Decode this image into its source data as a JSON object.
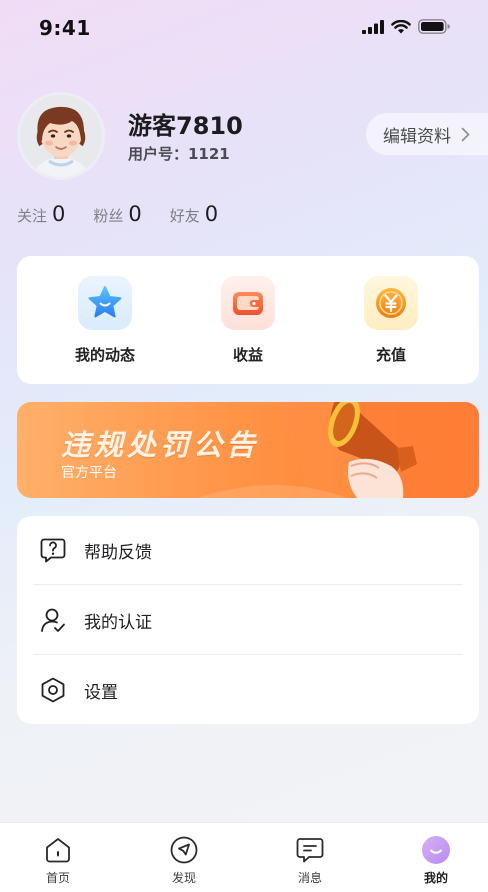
{
  "status_bar": {
    "time": "9:41"
  },
  "profile": {
    "username": "游客7810",
    "user_id": "用户号：1121",
    "edit_label": "编辑资料",
    "stats": [
      {
        "label": "关注",
        "value": "0"
      },
      {
        "label": "粉丝",
        "value": "0"
      },
      {
        "label": "好友",
        "value": "0"
      }
    ]
  },
  "quick_actions": [
    {
      "label": "我的动态",
      "icon": "star-icon"
    },
    {
      "label": "收益",
      "icon": "wallet-icon"
    },
    {
      "label": "充值",
      "icon": "yen-coin-icon"
    }
  ],
  "banner": {
    "title": "违规处罚公告",
    "subtitle": "官方平台"
  },
  "menu": [
    {
      "label": "帮助反馈",
      "icon": "help-chat-icon"
    },
    {
      "label": "我的认证",
      "icon": "user-verified-icon"
    },
    {
      "label": "设置",
      "icon": "settings-hexagon-icon"
    }
  ],
  "tabs": [
    {
      "label": "首页",
      "icon": "home-icon"
    },
    {
      "label": "发现",
      "icon": "compass-icon"
    },
    {
      "label": "消息",
      "icon": "message-icon"
    },
    {
      "label": "我的",
      "icon": "profile-smile-icon",
      "active": true
    }
  ],
  "colors": {
    "accent_purple": "#c79cf2",
    "banner_orange": "#ff8a3d",
    "star_blue": "#3aa3f5",
    "wallet_red": "#f2663a",
    "coin_orange": "#f79a1e"
  }
}
